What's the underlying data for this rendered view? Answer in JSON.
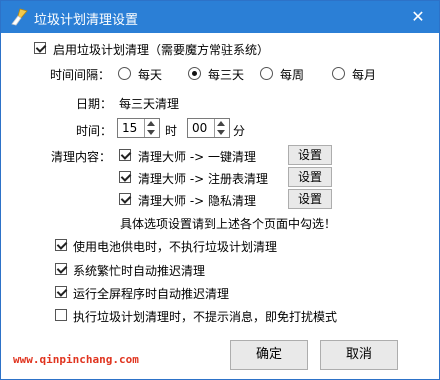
{
  "window": {
    "title": "垃圾计划清理设置",
    "close_glyph": "✕",
    "titlebar_color": "#2b7fd6"
  },
  "enable_plan": {
    "label": "启用垃圾计划清理（需要魔方常驻系统）",
    "checked": true
  },
  "interval": {
    "label": "时间间隔：",
    "options": [
      {
        "label": "每天",
        "selected": false
      },
      {
        "label": "每三天",
        "selected": true
      },
      {
        "label": "每周",
        "selected": false
      },
      {
        "label": "每月",
        "selected": false
      }
    ]
  },
  "date": {
    "label": "日期：",
    "value": "每三天清理"
  },
  "time": {
    "label": "时间：",
    "hour": "15",
    "hour_unit": "时",
    "minute": "00",
    "minute_unit": "分"
  },
  "clean_content": {
    "label": "清理内容：",
    "items": [
      {
        "label": "清理大师 -> 一键清理",
        "checked": true,
        "button": "设置"
      },
      {
        "label": "清理大师 -> 注册表清理",
        "checked": true,
        "button": "设置"
      },
      {
        "label": "清理大师 -> 隐私清理",
        "checked": true,
        "button": "设置"
      }
    ],
    "note": "具体选项设置请到上述各个页面中勾选！"
  },
  "options": [
    {
      "label": "使用电池供电时，不执行垃圾计划清理",
      "checked": true
    },
    {
      "label": "系统繁忙时自动推迟清理",
      "checked": true
    },
    {
      "label": "运行全屏程序时自动推迟清理",
      "checked": true
    },
    {
      "label": "执行垃圾计划清理时，不提示消息，即免打扰模式",
      "checked": false
    }
  ],
  "watermark": "www.qinpinchang.com",
  "buttons": {
    "ok": "确定",
    "cancel": "取消"
  }
}
